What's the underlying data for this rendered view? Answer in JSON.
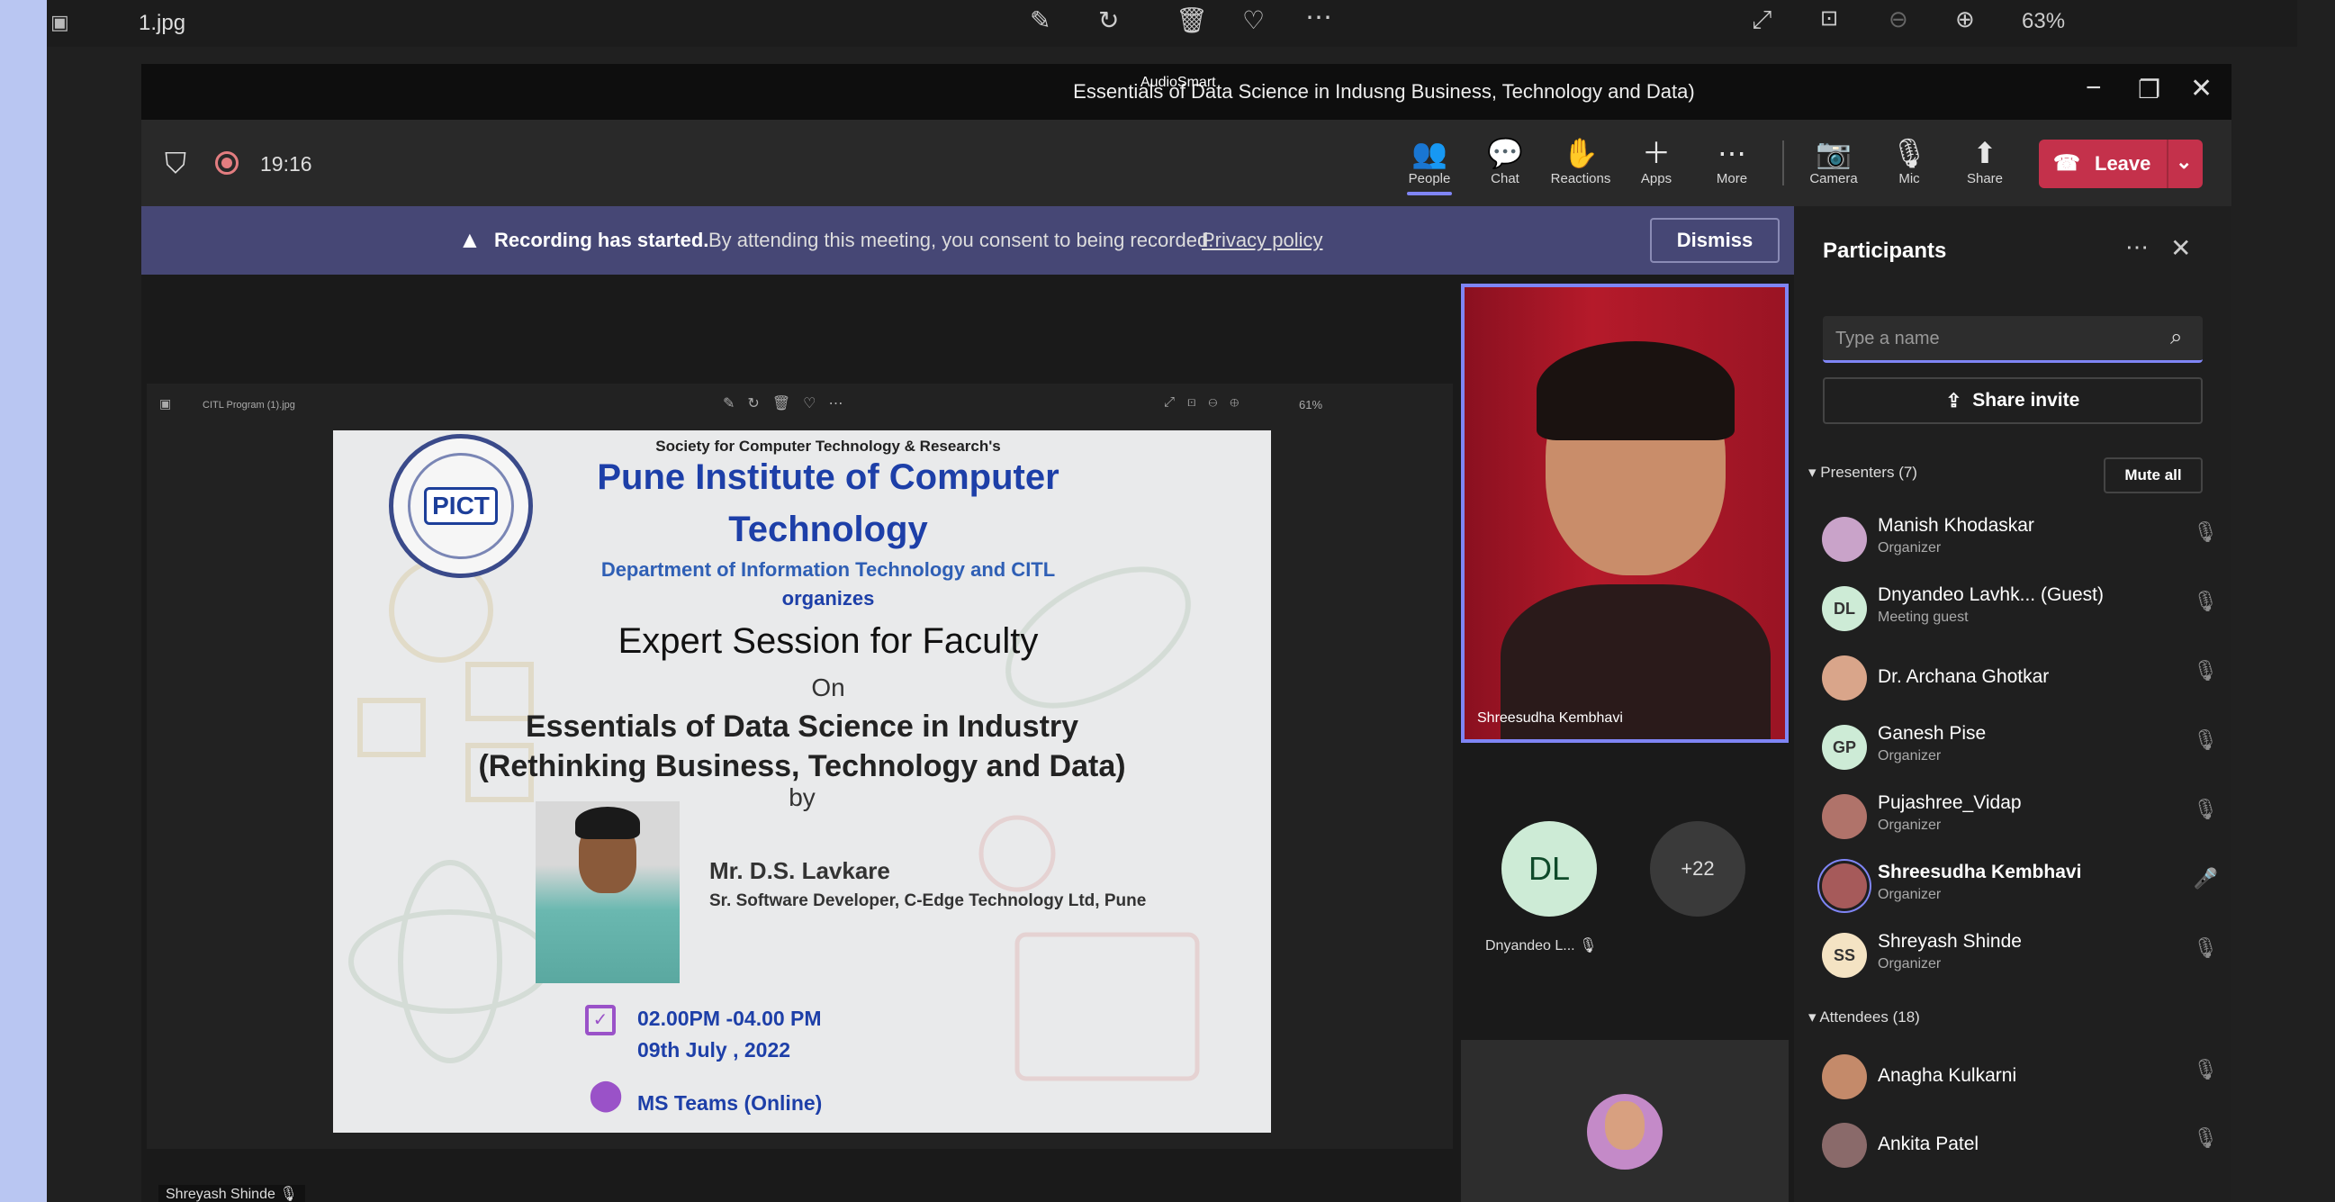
{
  "viewer": {
    "filename": "1.jpg",
    "zoom": "63%",
    "icons": [
      "gallery-icon",
      "edit-icon",
      "rotate-icon",
      "delete-icon",
      "heart-icon",
      "more-icon",
      "expand-icon",
      "fit-icon",
      "zoom-out-icon",
      "zoom-in-icon"
    ]
  },
  "window": {
    "title": "Essentials of Data Science in Indus",
    "title_rest": "ng Business, Technology and Data)",
    "overlay": "AudioSmart"
  },
  "meeting": {
    "timer": "19:16",
    "toolbar": [
      {
        "label": "People",
        "icon": "people-icon",
        "glyph": "👥"
      },
      {
        "label": "Chat",
        "icon": "chat-icon",
        "glyph": "💬"
      },
      {
        "label": "Reactions",
        "icon": "reactions-icon",
        "glyph": "✋"
      },
      {
        "label": "Apps",
        "icon": "apps-icon",
        "glyph": "＋"
      },
      {
        "label": "More",
        "icon": "more-icon",
        "glyph": "⋯"
      },
      {
        "label": "Camera",
        "icon": "camera-off-icon",
        "glyph": "📷"
      },
      {
        "label": "Mic",
        "icon": "mic-off-icon",
        "glyph": "🎙"
      },
      {
        "label": "Share",
        "icon": "share-icon",
        "glyph": "⬆"
      }
    ],
    "leave_label": "Leave"
  },
  "banner": {
    "bold": "Recording has started.",
    "text": "By attending this meeting, you consent to being recorded.",
    "link": "Privacy policy",
    "dismiss": "Dismiss"
  },
  "shared_viewer": {
    "filename": "CITL Program (1).jpg",
    "zoom": "61%"
  },
  "poster": {
    "society": "Society for Computer Technology & Research's",
    "logo": "PICT",
    "institute": "Pune Institute of Computer",
    "institute2": "Technology",
    "dept": "Department of Information Technology and CITL",
    "organizes": "organizes",
    "session": "Expert Session for Faculty",
    "on": "On",
    "topic1": "Essentials of Data Science in Industry",
    "topic2": "(Rethinking Business, Technology and Data)",
    "by": "by",
    "speaker": "Mr. D.S. Lavkare",
    "speaker_role": "Sr. Software Developer, C-Edge Technology Ltd, Pune",
    "time": "02.00PM -04.00 PM",
    "date": "09th July , 2022",
    "venue": "MS Teams (Online)"
  },
  "videos": {
    "main_name": "Shreesudha Kembhavi",
    "tile_initials": "DL",
    "tile_name": "Dnyandeo L...",
    "more_count": "+22",
    "presenter_label": "Shreyash Shinde"
  },
  "panel": {
    "title": "Participants",
    "search_placeholder": "Type a name",
    "share_invite": "Share invite",
    "presenters_label": "Presenters (7)",
    "mute_all": "Mute all",
    "attendees_label": "Attendees (18)",
    "presenters": [
      {
        "name": "Manish Khodaskar",
        "role": "Organizer",
        "initials": "",
        "color": "#c9a3c9"
      },
      {
        "name": "Dnyandeo Lavhk... (Guest)",
        "role": "Meeting guest",
        "initials": "DL",
        "color": "#cdebd6"
      },
      {
        "name": "Dr. Archana Ghotkar",
        "role": "",
        "initials": "",
        "color": "#d9a58a"
      },
      {
        "name": "Ganesh Pise",
        "role": "Organizer",
        "initials": "GP",
        "color": "#cdebd6"
      },
      {
        "name": "Pujashree_Vidap",
        "role": "Organizer",
        "initials": "",
        "color": "#b0736a"
      },
      {
        "name": "Shreesudha Kembhavi",
        "role": "Organizer",
        "initials": "",
        "color": "#a65a5a"
      },
      {
        "name": "Shreyash Shinde",
        "role": "Organizer",
        "initials": "SS",
        "color": "#f4e3c3"
      }
    ],
    "attendees": [
      {
        "name": "Anagha Kulkarni",
        "role": "",
        "initials": "",
        "color": "#c48a6a"
      },
      {
        "name": "Ankita Patel",
        "role": "",
        "initials": "",
        "color": "#8a6a6a"
      }
    ]
  }
}
